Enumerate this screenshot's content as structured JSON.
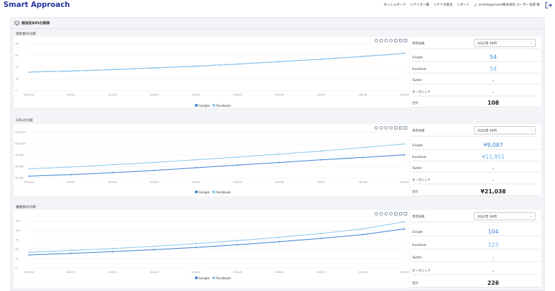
{
  "app": {
    "brand": "Smart Approach"
  },
  "nav": {
    "items": [
      "ダッシュボード",
      "シナリオ一覧",
      "シナリオ発注",
      "レポート"
    ],
    "user": "smartapproach株式会社 ユーザー北郎 様"
  },
  "page": {
    "panel_title": "媒体別KPIの推移"
  },
  "colors": {
    "brand": "#23349a",
    "google": "#3a7fd4",
    "facebook": "#86c6f0"
  },
  "icons": [
    "monitor-icon",
    "user-icon",
    "logout-icon",
    "restore-icon",
    "zoom-in-icon",
    "zoom-out-icon",
    "refresh-icon",
    "hand-icon",
    "home-icon",
    "list-icon"
  ],
  "sections": [
    {
      "title": "契約数の比較",
      "select_label": "単月詳細",
      "selected_month": "2022年 09月",
      "rows": [
        {
          "label": "Google",
          "value": "54",
          "kind": "google"
        },
        {
          "label": "Facebook",
          "value": "54",
          "kind": "facebook"
        },
        {
          "label": "Twitter",
          "value": "-",
          "kind": "dash"
        },
        {
          "label": "オーガニック",
          "value": "-",
          "kind": "dash"
        },
        {
          "label": "合計",
          "value": "108",
          "kind": "total"
        }
      ],
      "legend": [
        "Google",
        "Facebook"
      ]
    },
    {
      "title": "CACの比較",
      "select_label": "単月詳細",
      "selected_month": "2022年 09月",
      "rows": [
        {
          "label": "Google",
          "value": "¥9,087",
          "kind": "google"
        },
        {
          "label": "Facebook",
          "value": "¥11,951",
          "kind": "facebook"
        },
        {
          "label": "Twitter",
          "value": "-",
          "kind": "dash"
        },
        {
          "label": "オーガニック",
          "value": "-",
          "kind": "dash"
        },
        {
          "label": "合計",
          "value": "¥21,038",
          "kind": "total"
        }
      ],
      "legend": [
        "Google",
        "Facebook"
      ]
    },
    {
      "title": "離脱数の比較",
      "select_label": "単月詳細",
      "selected_month": "2022年 09月",
      "rows": [
        {
          "label": "Google",
          "value": "104",
          "kind": "google"
        },
        {
          "label": "Facebook",
          "value": "123",
          "kind": "facebook"
        },
        {
          "label": "Twitter",
          "value": "-",
          "kind": "dash"
        },
        {
          "label": "オーガニック",
          "value": "-",
          "kind": "dash"
        },
        {
          "label": "合計",
          "value": "226",
          "kind": "total"
        }
      ],
      "legend": [
        "Google",
        "Facebook"
      ]
    }
  ],
  "chart_data": [
    {
      "type": "line",
      "title": "契約数の比較",
      "categories": [
        "2021/12",
        "2022/1",
        "2022/2",
        "2022/3",
        "2022/4",
        "2022/5",
        "2022/6",
        "2022/7",
        "2022/8",
        "2022/9"
      ],
      "ylim": [
        0,
        68
      ],
      "yticks": [
        "0",
        "14",
        "27",
        "41",
        "54"
      ],
      "series": [
        {
          "name": "Google",
          "color": "#3a7fd4",
          "values": [
            27,
            28.5,
            30.5,
            33,
            35.5,
            38.5,
            42,
            45.5,
            49.5,
            54
          ]
        },
        {
          "name": "Facebook",
          "color": "#86c6f0",
          "values": [
            27,
            28.5,
            30.5,
            33,
            35.5,
            38.5,
            42,
            45.5,
            49.5,
            54
          ]
        }
      ],
      "legend_position": "bottom"
    },
    {
      "type": "line",
      "title": "CACの比較",
      "categories": [
        "2021/12",
        "2022/1",
        "2022/2",
        "2022/3",
        "2022/4",
        "2022/5",
        "2022/6",
        "2022/7",
        "2022/8",
        "2022/9"
      ],
      "ylim": [
        3000,
        15000
      ],
      "yticks": [
        "¥3,000",
        "¥6,000",
        "¥9,000",
        "¥12,000",
        "¥15,000"
      ],
      "series": [
        {
          "name": "Google",
          "color": "#3a7fd4",
          "values": [
            3500,
            3900,
            4400,
            5000,
            5700,
            6400,
            7100,
            7800,
            8400,
            9087
          ]
        },
        {
          "name": "Facebook",
          "color": "#86c6f0",
          "values": [
            5400,
            5900,
            6500,
            7100,
            7800,
            8500,
            9300,
            10100,
            11000,
            11951
          ]
        }
      ],
      "legend_position": "bottom"
    },
    {
      "type": "line",
      "title": "離脱数の比較",
      "categories": [
        "2021/12",
        "2022/1",
        "2022/2",
        "2022/3",
        "2022/4",
        "2022/5",
        "2022/6",
        "2022/7",
        "2022/8",
        "2022/9"
      ],
      "ylim": [
        0,
        125
      ],
      "yticks": [
        "0",
        "25",
        "50",
        "75",
        "100",
        "125"
      ],
      "series": [
        {
          "name": "Google",
          "color": "#3a7fd4",
          "values": [
            35,
            39,
            44,
            49,
            55,
            62,
            70,
            79,
            89,
            104
          ]
        },
        {
          "name": "Facebook",
          "color": "#86c6f0",
          "values": [
            42,
            47,
            52,
            58,
            65,
            73,
            82,
            92,
            104,
            123
          ]
        }
      ],
      "legend_position": "bottom"
    }
  ]
}
